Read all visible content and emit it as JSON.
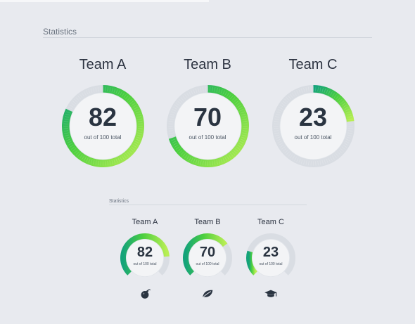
{
  "large": {
    "title": "Statistics",
    "teams": [
      {
        "name": "Team A",
        "value": "82",
        "progress": 0.82,
        "subtitle": "out of 100 total"
      },
      {
        "name": "Team B",
        "value": "70",
        "progress": 0.7,
        "subtitle": "out of 100 total"
      },
      {
        "name": "Team C",
        "value": "23",
        "progress": 0.23,
        "subtitle": "out of 100 total"
      }
    ]
  },
  "small": {
    "title": "Statistics",
    "teams": [
      {
        "name": "Team A",
        "value": "82",
        "progress": 0.82,
        "subtitle": "out of 100 total",
        "icon": "bomb-icon"
      },
      {
        "name": "Team B",
        "value": "70",
        "progress": 0.7,
        "subtitle": "out of 100 total",
        "icon": "leaf-icon"
      },
      {
        "name": "Team C",
        "value": "23",
        "progress": 0.23,
        "subtitle": "out of 100 total",
        "icon": "graduation-cap-icon"
      }
    ]
  },
  "colors": {
    "background": "#e8eaef",
    "track": "#d9dde3",
    "inner": "#f3f4f6",
    "dark_green": "#14a37a",
    "mid_green": "#4ccf3f",
    "light_green": "#b8ee54",
    "text_dark": "#2a3441",
    "text_muted": "#6b7480"
  }
}
